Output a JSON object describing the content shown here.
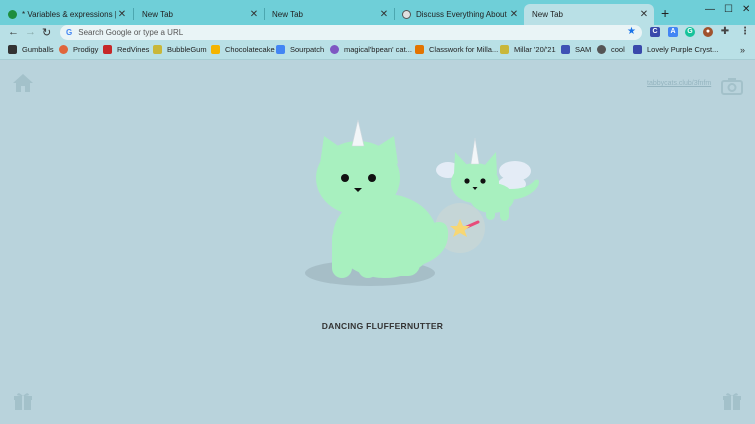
{
  "tabs": [
    {
      "title": "* Variables & expressions | 6th...",
      "favicon_color": "#1e8e3e",
      "active": false
    },
    {
      "title": "New Tab",
      "favicon_color": "",
      "active": false
    },
    {
      "title": "New Tab",
      "favicon_color": "",
      "active": false
    },
    {
      "title": "Discuss Everything About Tabb...",
      "favicon_color": "#555555",
      "active": false
    },
    {
      "title": "New Tab",
      "favicon_color": "",
      "active": true
    }
  ],
  "toolbar": {
    "search_placeholder": "Search Google or type a URL",
    "google_g": "G"
  },
  "bookmarks": [
    {
      "label": "Gumballs",
      "color": "#333333"
    },
    {
      "label": "Prodigy",
      "color": "#e0663c"
    },
    {
      "label": "RedVines",
      "color": "#c62828"
    },
    {
      "label": "BubbleGum",
      "color": "#c9b73a"
    },
    {
      "label": "Chocolatecake",
      "color": "#f4b400"
    },
    {
      "label": "Sourpatch",
      "color": "#4285f4"
    },
    {
      "label": "magical'bpean' cat...",
      "color": "#7e57c2"
    },
    {
      "label": "Classwork for Milla...",
      "color": "#e37400"
    },
    {
      "label": "Millar '20/'21",
      "color": "#c9b73a"
    },
    {
      "label": "SAM",
      "color": "#3f51b5"
    },
    {
      "label": "cool",
      "color": "#555555"
    },
    {
      "label": "Lovely Purple Cryst...",
      "color": "#3949ab"
    }
  ],
  "page": {
    "credit": "tabbycats.club/3fnfm",
    "cat_name": "DANCING FLUFFERNUTTER",
    "background": "#b9d3dc",
    "cat_color": "#a8f0bf"
  }
}
